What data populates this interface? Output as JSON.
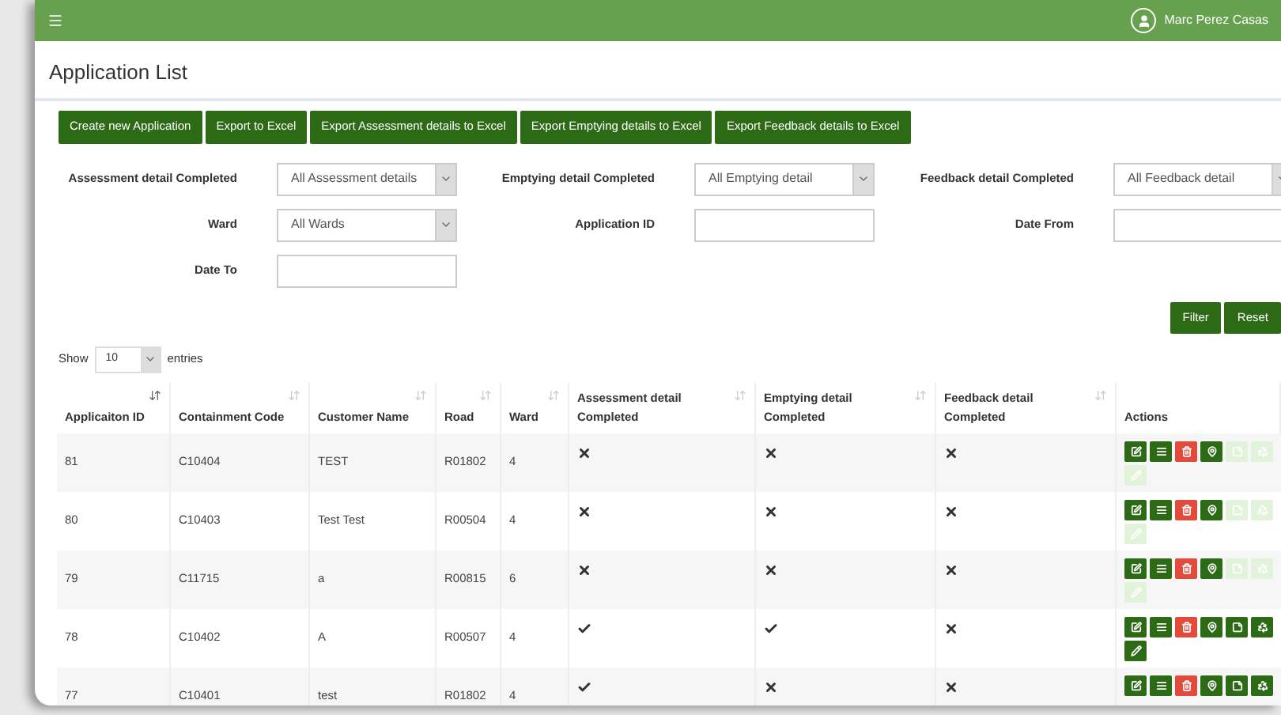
{
  "header": {
    "user": "Marc Perez Casas"
  },
  "title": "Application List",
  "toolbar": [
    "Create new Application",
    "Export to Excel",
    "Export Assessment details to Excel",
    "Export Emptying details to Excel",
    "Export Feedback details to Excel"
  ],
  "filters": [
    {
      "label": "Assessment detail Completed",
      "kind": "select",
      "value": "All Assessment details"
    },
    {
      "label": "Emptying detail Completed",
      "kind": "select",
      "value": "All Emptying detail"
    },
    {
      "label": "Feedback detail Completed",
      "kind": "select",
      "value": "All Feedback detail"
    },
    {
      "label": "Ward",
      "kind": "select",
      "value": "All Wards"
    },
    {
      "label": "Application ID",
      "kind": "text"
    },
    {
      "label": "Date From",
      "kind": "text"
    },
    {
      "label": "Date To",
      "kind": "text"
    }
  ],
  "filter_buttons": [
    "Filter",
    "Reset"
  ],
  "length": {
    "before": "Show",
    "value": "10",
    "after": "entries"
  },
  "table": {
    "columns": [
      {
        "label": "Applicaiton ID",
        "sorted": true
      },
      {
        "label": "Containment Code",
        "sorted": false
      },
      {
        "label": "Customer Name",
        "sorted": false
      },
      {
        "label": "Road",
        "sorted": false
      },
      {
        "label": "Ward",
        "sorted": false
      },
      {
        "label": "Assessment detail Completed",
        "sorted": false
      },
      {
        "label": "Emptying detail Completed",
        "sorted": false
      },
      {
        "label": "Feedback detail Completed",
        "sorted": false
      },
      {
        "label": "Actions"
      }
    ],
    "rows": [
      {
        "id": "81",
        "code": "C10404",
        "customer": "TEST",
        "road": "R01802",
        "ward": "4",
        "assessment": false,
        "emptying": false,
        "feedback": false,
        "actions": [
          {
            "kind": "edit",
            "disabled": false
          },
          {
            "kind": "list",
            "disabled": false
          },
          {
            "kind": "delete",
            "disabled": false
          },
          {
            "kind": "map",
            "disabled": false
          },
          {
            "kind": "note",
            "disabled": true
          },
          {
            "kind": "recycle",
            "disabled": true
          },
          {
            "kind": "pencil",
            "disabled": true
          }
        ]
      },
      {
        "id": "80",
        "code": "C10403",
        "customer": "Test Test",
        "road": "R00504",
        "ward": "4",
        "assessment": false,
        "emptying": false,
        "feedback": false,
        "actions": [
          {
            "kind": "edit",
            "disabled": false
          },
          {
            "kind": "list",
            "disabled": false
          },
          {
            "kind": "delete",
            "disabled": false
          },
          {
            "kind": "map",
            "disabled": false
          },
          {
            "kind": "note",
            "disabled": true
          },
          {
            "kind": "recycle",
            "disabled": true
          },
          {
            "kind": "pencil",
            "disabled": true
          }
        ]
      },
      {
        "id": "79",
        "code": "C11715",
        "customer": "a",
        "road": "R00815",
        "ward": "6",
        "assessment": false,
        "emptying": false,
        "feedback": false,
        "actions": [
          {
            "kind": "edit",
            "disabled": false
          },
          {
            "kind": "list",
            "disabled": false
          },
          {
            "kind": "delete",
            "disabled": false
          },
          {
            "kind": "map",
            "disabled": false
          },
          {
            "kind": "note",
            "disabled": true
          },
          {
            "kind": "recycle",
            "disabled": true
          },
          {
            "kind": "pencil",
            "disabled": true
          }
        ]
      },
      {
        "id": "78",
        "code": "C10402",
        "customer": "A",
        "road": "R00507",
        "ward": "4",
        "assessment": true,
        "emptying": true,
        "feedback": false,
        "actions": [
          {
            "kind": "edit",
            "disabled": false
          },
          {
            "kind": "list",
            "disabled": false
          },
          {
            "kind": "delete",
            "disabled": false
          },
          {
            "kind": "map",
            "disabled": false
          },
          {
            "kind": "note",
            "disabled": false
          },
          {
            "kind": "recycle",
            "disabled": false
          },
          {
            "kind": "pencil",
            "disabled": false
          }
        ]
      },
      {
        "id": "77",
        "code": "C10401",
        "customer": "test",
        "road": "R01802",
        "ward": "4",
        "assessment": true,
        "emptying": false,
        "feedback": false,
        "actions": [
          {
            "kind": "edit",
            "disabled": false
          },
          {
            "kind": "list",
            "disabled": false
          },
          {
            "kind": "delete",
            "disabled": false
          },
          {
            "kind": "map",
            "disabled": false
          },
          {
            "kind": "note",
            "disabled": false
          },
          {
            "kind": "recycle",
            "disabled": false
          }
        ]
      }
    ]
  }
}
